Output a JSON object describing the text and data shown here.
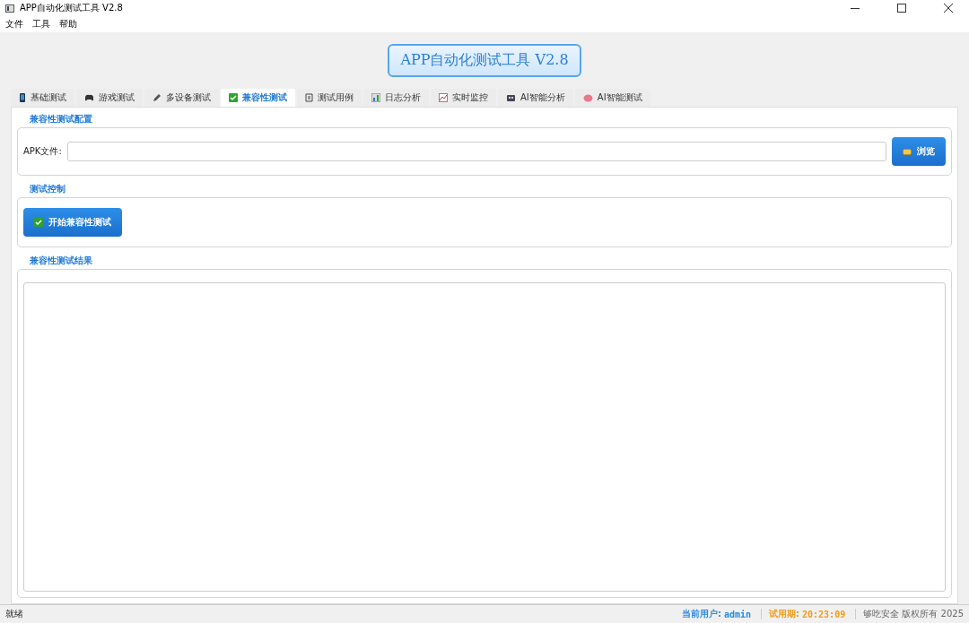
{
  "window": {
    "title": "APP自动化测试工具 V2.8"
  },
  "menu": [
    "文件",
    "工具",
    "帮助"
  ],
  "banner": "APP自动化测试工具 V2.8",
  "tabs": [
    {
      "label": "基础测试",
      "selected": false
    },
    {
      "label": "游戏测试",
      "selected": false
    },
    {
      "label": "多设备测试",
      "selected": false
    },
    {
      "label": "兼容性测试",
      "selected": true
    },
    {
      "label": "测试用例",
      "selected": false
    },
    {
      "label": "日志分析",
      "selected": false
    },
    {
      "label": "实时监控",
      "selected": false
    },
    {
      "label": "AI智能分析",
      "selected": false
    },
    {
      "label": "AI智能测试",
      "selected": false
    }
  ],
  "config": {
    "title": "兼容性测试配置",
    "field_label": "APK文件:",
    "browse": "浏览"
  },
  "control": {
    "title": "测试控制",
    "start": "开始兼容性测试"
  },
  "results": {
    "title": "兼容性测试结果"
  },
  "status_bar": {
    "status": "就绪",
    "user_label": "当前用户:",
    "user": "admin",
    "trial_label": "试用期:",
    "trial": "20:23:09",
    "copyright": "够吃安全 版权所有 2025"
  }
}
